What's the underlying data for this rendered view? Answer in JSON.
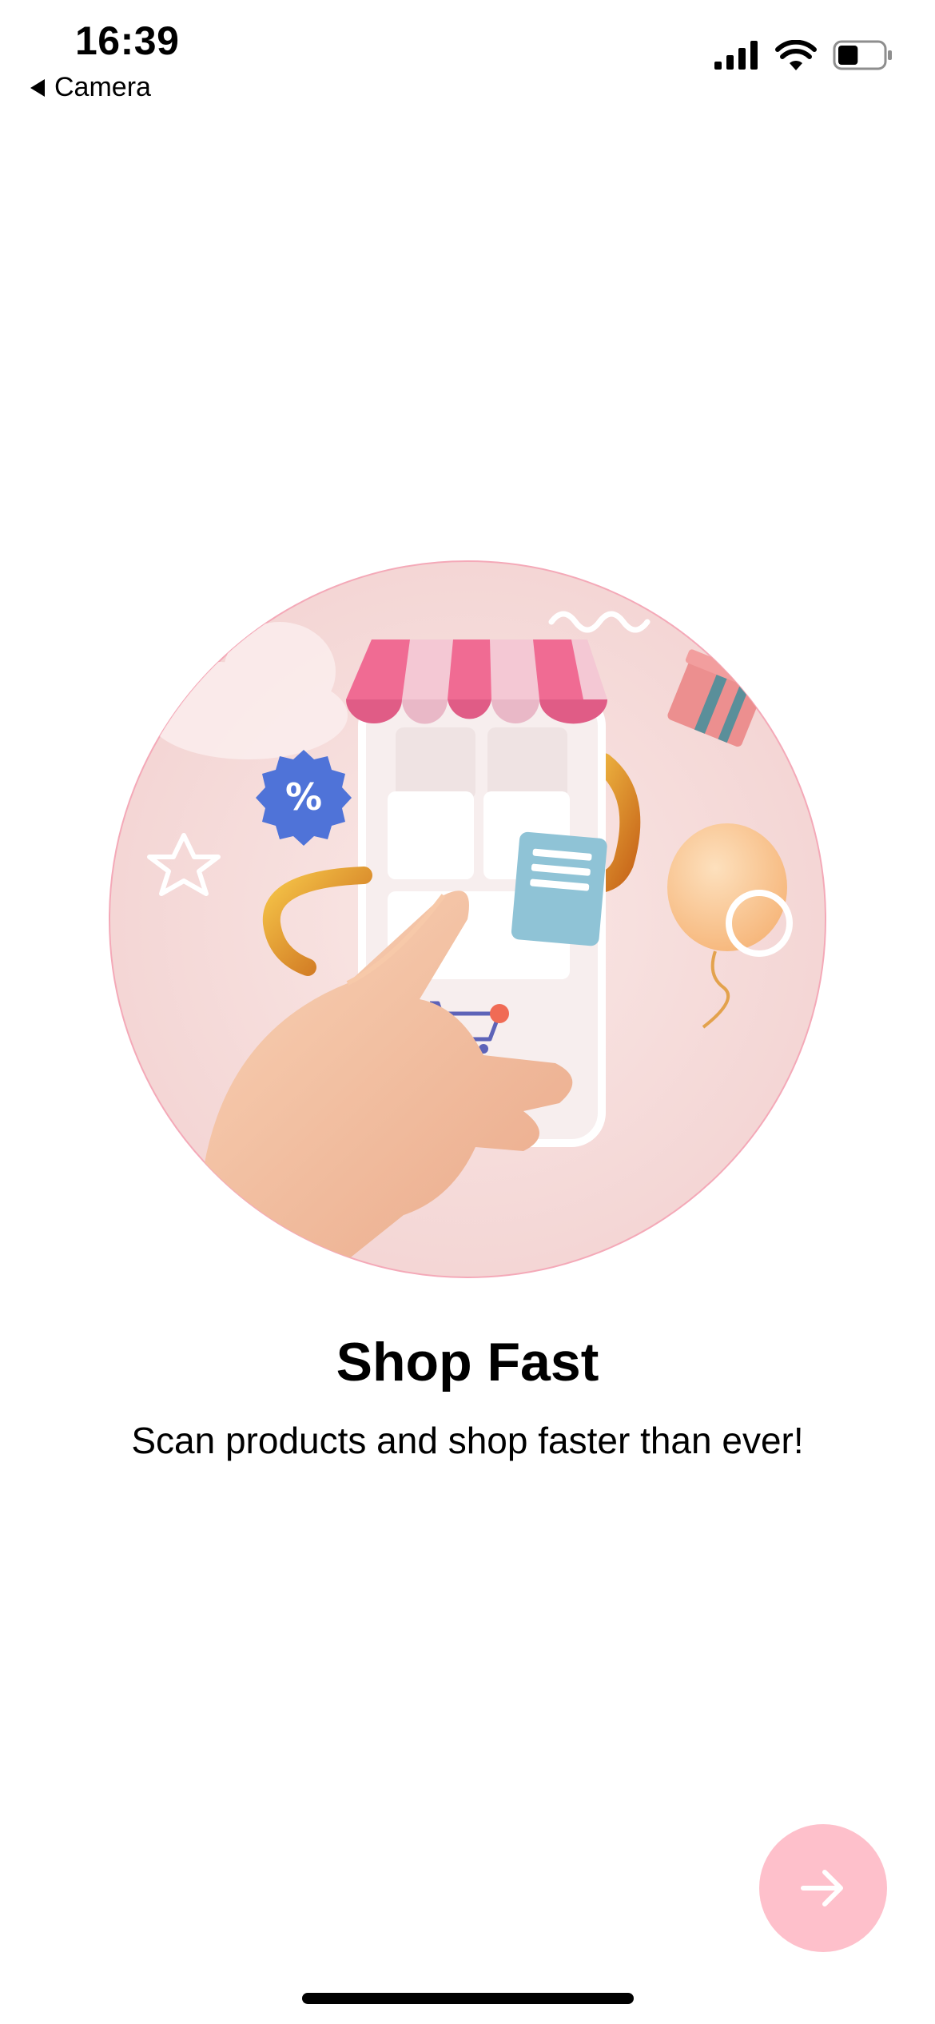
{
  "status_bar": {
    "time": "16:39",
    "back_label": "Camera",
    "battery_percent": 45
  },
  "onboarding": {
    "title": "Shop Fast",
    "subtitle": "Scan products and shop faster than ever!",
    "illustration_badge": "%"
  },
  "colors": {
    "accent": "#fec0cb",
    "awning_pink": "#f06b93",
    "circle_bg": "#f6dcdc"
  },
  "icons": {
    "next": "arrow-right-icon",
    "back": "back-triangle-icon"
  }
}
